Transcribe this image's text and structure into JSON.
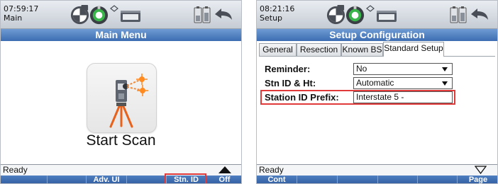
{
  "screens": [
    {
      "clock_time": "07:59:17",
      "context": "Main",
      "title": "Main Menu",
      "start_label": "Start Scan",
      "status": "Ready",
      "softkeys": [
        "",
        "",
        "Adv. UI",
        "",
        "Stn. ID",
        "Off"
      ],
      "highlight_color": "#e03a3a"
    },
    {
      "clock_time": "08:21:16",
      "context": "Setup",
      "title": "Setup Configuration",
      "tabs": [
        "General",
        "Resection",
        "Known BS",
        "Standard Setup"
      ],
      "active_tab": "Standard Setup",
      "fields": {
        "reminder_label": "Reminder:",
        "reminder_value": "No",
        "stn_label": "Stn ID & Ht:",
        "stn_value": "Automatic",
        "prefix_label": "Station ID Prefix:",
        "prefix_value": "Interstate 5 -"
      },
      "status": "Ready",
      "softkeys": [
        "Cont",
        "",
        "",
        "",
        "",
        "Page"
      ],
      "highlight_color": "#e03a3a"
    }
  ],
  "icons": [
    "target-icon",
    "prism-icon",
    "link-icon",
    "radio-icon",
    "battery-icon",
    "back-arrow-icon",
    "total-station-icon"
  ]
}
